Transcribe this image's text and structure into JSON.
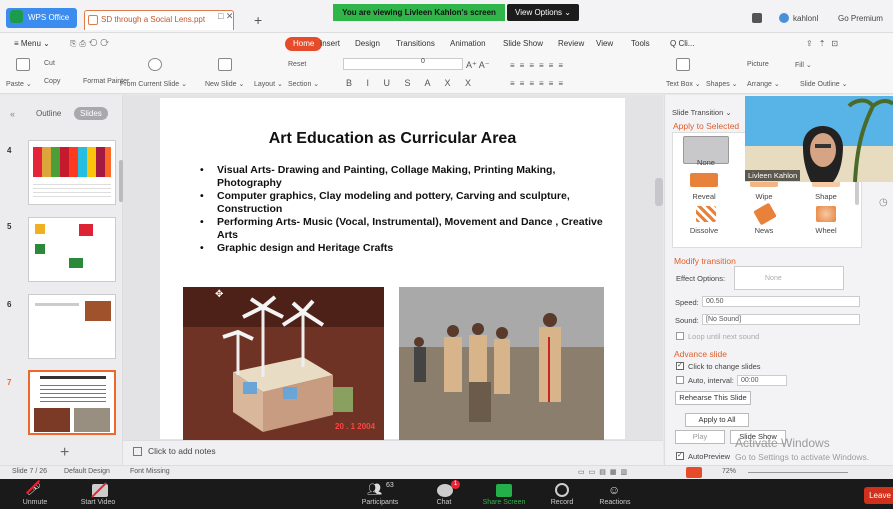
{
  "titlebar": {
    "app_tab": "WPS Office",
    "doc_tab": "SD through a Social Lens.ppt",
    "doc_close": "□ ✕",
    "new_tab": "+",
    "share_banner": "You are viewing Livleen Kahlon's screen",
    "view_options": "View Options ⌄",
    "user": "kahlonl",
    "go_premium": "Go Premium"
  },
  "menu": {
    "menu_label": "≡ Menu ⌄",
    "tabs": [
      "Home",
      "Insert",
      "Design",
      "Transitions",
      "Animation",
      "Slide Show",
      "Review",
      "View",
      "Tools"
    ],
    "search": "Q Cli..."
  },
  "ribbon": {
    "paste": "Paste ⌄",
    "cut": "Cut",
    "copy": "Copy",
    "format_painter": "Format Painter",
    "from_current": "From Current Slide ⌄",
    "new_slide": "New Slide ⌄",
    "layout": "Layout ⌄",
    "reset": "Reset",
    "section": "Section ⌄",
    "font_size": "0",
    "text_box": "Text Box ⌄",
    "shapes": "Shapes ⌄",
    "picture": "Picture",
    "fill": "Fill ⌄",
    "arrange": "Arrange ⌄",
    "slide_outline": "Slide Outline ⌄"
  },
  "left_panel": {
    "outline": "Outline",
    "slides": "Slides",
    "slide_numbers": [
      "4",
      "5",
      "6",
      "7"
    ],
    "add": "+"
  },
  "slide": {
    "title": "Art Education as Curricular Area",
    "bullets": [
      "Visual Arts- Drawing and Painting, Collage Making, Printing Making, Photography",
      "Computer graphics, Clay modeling and pottery, Carving and sculpture, Construction",
      "Performing Arts- Music (Vocal, Instrumental), Movement and Dance , Creative Arts",
      "Graphic design and Heritage Crafts"
    ],
    "photo_date": "20 . 1 2004"
  },
  "notes": {
    "placeholder": "Click to add notes"
  },
  "right_panel": {
    "panel_title": "Slide Transition ⌄",
    "apply_to": "Apply to Selected",
    "transitions": [
      "None",
      "Reveal",
      "Wipe",
      "Shape",
      "Dissolve",
      "News",
      "Wheel"
    ],
    "modify_header": "Modify transition",
    "effect_label": "Effect Options:",
    "effect_value": "None",
    "speed_label": "Speed:",
    "speed_value": "00.50",
    "sound_label": "Sound:",
    "sound_value": "[No Sound]",
    "loop_label": "Loop until next sound",
    "advance_header": "Advance slide",
    "click_label": "Click to change slides",
    "auto_label": "Auto, interval:",
    "auto_value": "00:00",
    "rehearse": "Rehearse This Slide",
    "apply_all": "Apply to All",
    "play": "Play",
    "slide_show": "Slide Show",
    "autopreview": "AutoPreview"
  },
  "video": {
    "name": "Livleen Kahlon"
  },
  "watermark": {
    "line1": "Activate Windows",
    "line2": "Go to Settings to activate Windows."
  },
  "statusbar": {
    "slide_count": "Slide 7 / 26",
    "design": "Default Design",
    "font_missing": "Font Missing",
    "zoom": "72%"
  },
  "zoom_toolbar": {
    "unmute": "Unmute",
    "start_video": "Start Video",
    "participants": "Participants",
    "participant_count": "63",
    "chat": "Chat",
    "chat_badge": "1",
    "share_screen": "Share Screen",
    "record": "Record",
    "reactions": "Reactions",
    "leave": "Leave"
  },
  "colors": {
    "accent": "#e74c2a",
    "wps_blue": "#3c8cf0",
    "zoom_green": "#2fb54a",
    "leave_red": "#d1301c"
  }
}
